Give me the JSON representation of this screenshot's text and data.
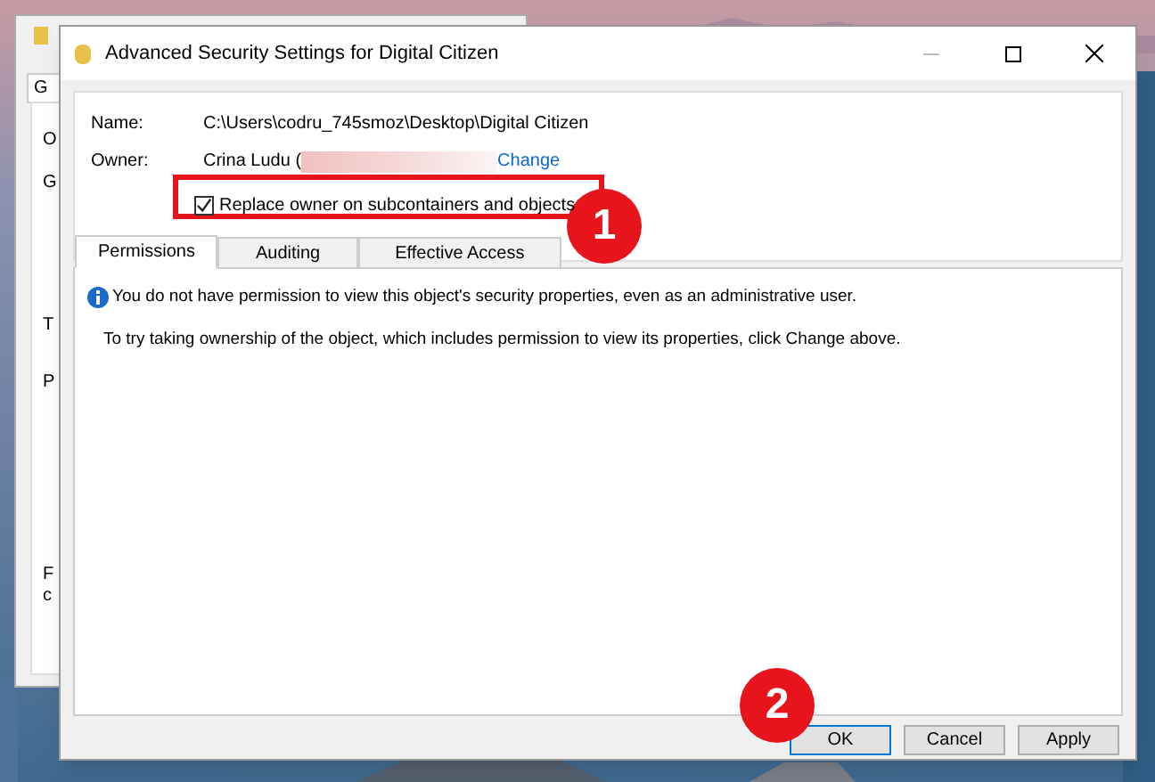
{
  "background_window": {
    "tab": "G",
    "fragments": [
      "O",
      "G",
      "T",
      "P",
      "F",
      "c"
    ]
  },
  "window": {
    "title": "Advanced Security Settings for Digital Citizen"
  },
  "name": {
    "label": "Name:",
    "value": "C:\\Users\\codru_745smoz\\Desktop\\Digital Citizen"
  },
  "owner": {
    "label": "Owner:",
    "value": "Crina Ludu (",
    "link": "Change"
  },
  "replace_owner": {
    "label": "Replace owner on subcontainers and objects",
    "checked": true
  },
  "tabs": [
    {
      "label": "Permissions",
      "selected": true
    },
    {
      "label": "Auditing",
      "selected": false
    },
    {
      "label": "Effective Access",
      "selected": false
    }
  ],
  "info_message": "You do not have permission to view this object's security properties, even as an administrative user.",
  "hint": "To try taking ownership of the object, which includes permission to view its properties, click Change above.",
  "buttons": [
    {
      "label": "OK",
      "default": true
    },
    {
      "label": "Cancel",
      "default": false
    },
    {
      "label": "Apply",
      "default": false
    }
  ],
  "callouts": [
    "1",
    "2"
  ]
}
